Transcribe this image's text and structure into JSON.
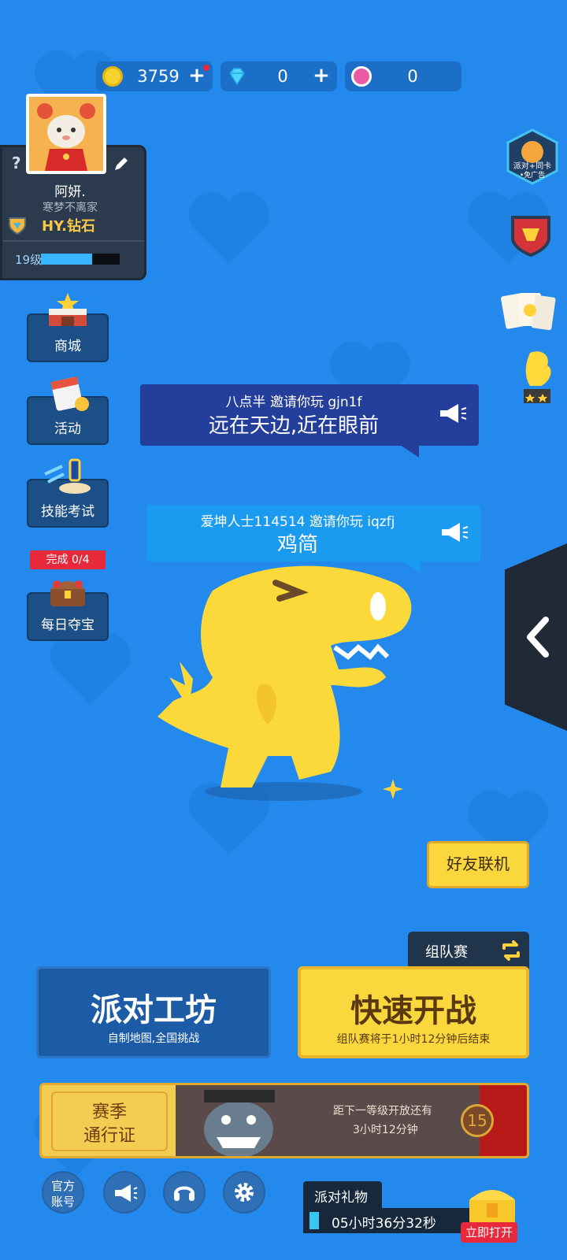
{
  "currency": {
    "coins": "3759",
    "diamonds": "0",
    "lotus": "0"
  },
  "profile": {
    "help_mark": "?",
    "name": "阿妍.",
    "motto": "寒梦不离家",
    "rank": "HY.钻石",
    "level": "19级",
    "level_progress": 0.65
  },
  "side_menu": {
    "shop": "商城",
    "events": "活动",
    "skill_test": "技能考试",
    "daily_status": "完成 0/4",
    "daily_treasure": "每日夺宝"
  },
  "right_rail": {
    "party_card": "派对+同卡",
    "no_ad": "•免广告"
  },
  "invites": [
    {
      "line1": "八点半 邀请你玩 gjn1f",
      "line2": "远在天边,近在眼前"
    },
    {
      "line1": "爱坤人士114514 邀请你玩 iqzfj",
      "line2": "鸡简"
    }
  ],
  "friend_online_label": "好友联机",
  "team_mode": {
    "label": "组队赛"
  },
  "workshop": {
    "title": "派对工坊",
    "subtitle": "自制地图,全国挑战"
  },
  "quick_battle": {
    "title": "快速开战",
    "subtitle": "组队赛将于1小时12分钟后结束"
  },
  "season_pass": {
    "title_line1": "赛季",
    "title_line2": "通行证",
    "next_level_line1": "距下一等级开放还有",
    "next_level_line2": "3小时12分钟",
    "level": "15"
  },
  "bottom_bar": {
    "official_account_line1": "官方",
    "official_account_line2": "账号",
    "party_gift": "派对礼物",
    "timer": "05小时36分32秒",
    "open_now": "立即打开"
  },
  "colors": {
    "background": "#2389ec",
    "dark_panel": "#2b3a4d",
    "yellow": "#f9d73d",
    "gold_text": "#f8c847",
    "accent_red": "#e8283b"
  }
}
